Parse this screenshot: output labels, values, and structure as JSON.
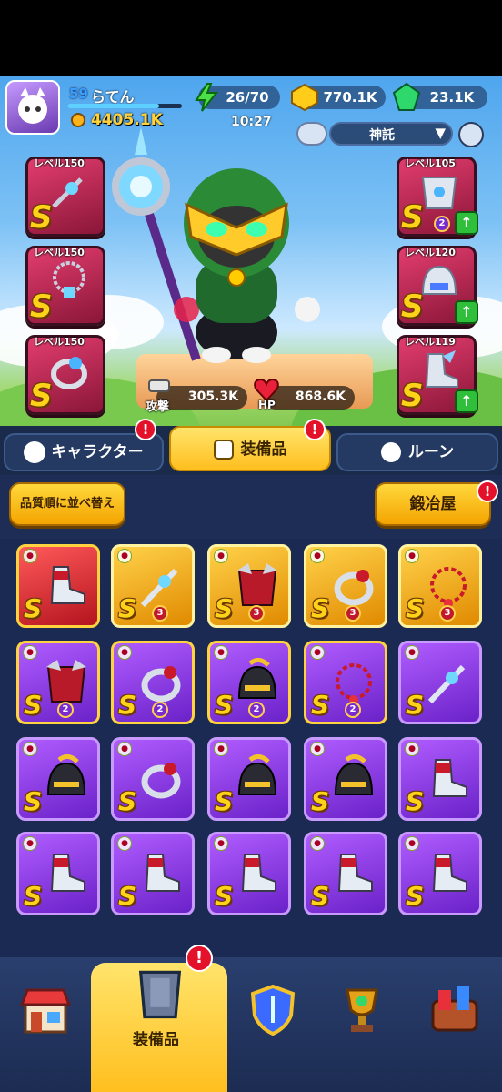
{
  "player": {
    "level": "59",
    "name": "らてん",
    "power": "4405.1K",
    "time": "10:27"
  },
  "resources": {
    "energy": "26/70",
    "gold": "770.1K",
    "gems": "23.1K"
  },
  "title_select": {
    "value": "神託"
  },
  "stats": {
    "attack_label": "攻撃",
    "attack": "305.3K",
    "hp_label": "HP",
    "hp": "868.6K"
  },
  "slots": {
    "left": [
      {
        "label": "レベル150",
        "grade": "S"
      },
      {
        "label": "レベル150",
        "grade": "S"
      },
      {
        "label": "レベル150",
        "grade": "S"
      }
    ],
    "right": [
      {
        "label": "レベル105",
        "grade": "S",
        "count": "2"
      },
      {
        "label": "レベル120",
        "grade": "S"
      },
      {
        "label": "レベル119",
        "grade": "S"
      }
    ]
  },
  "tabs": {
    "character": "キャラクター",
    "equipment": "装備品",
    "rune": "ルーン",
    "badge": "!"
  },
  "buttons": {
    "sort": "品質順に並べ替え",
    "forge": "鍛冶屋"
  },
  "inventory": {
    "rows": [
      [
        {
          "grade": "S",
          "rarity": "red",
          "item": "boots"
        },
        {
          "grade": "S",
          "rarity": "gold",
          "item": "weapon",
          "n": "3"
        },
        {
          "grade": "S",
          "rarity": "gold",
          "item": "armor",
          "n": "3"
        },
        {
          "grade": "S",
          "rarity": "gold",
          "item": "ring",
          "n": "3"
        },
        {
          "grade": "S",
          "rarity": "gold",
          "item": "necklace",
          "n": "3"
        }
      ],
      [
        {
          "grade": "S",
          "rarity": "purpleY",
          "item": "armor",
          "n": "2"
        },
        {
          "grade": "S",
          "rarity": "purpleY",
          "item": "ring",
          "n": "2"
        },
        {
          "grade": "S",
          "rarity": "purpleY",
          "item": "helmet",
          "n": "2"
        },
        {
          "grade": "S",
          "rarity": "purpleY",
          "item": "necklace",
          "n": "2"
        },
        {
          "grade": "S",
          "rarity": "purple",
          "item": "weapon"
        }
      ],
      [
        {
          "grade": "S",
          "rarity": "purple",
          "item": "helmet"
        },
        {
          "grade": "S",
          "rarity": "purple",
          "item": "ring"
        },
        {
          "grade": "S",
          "rarity": "purple",
          "item": "helmet"
        },
        {
          "grade": "S",
          "rarity": "purple",
          "item": "helmet"
        },
        {
          "grade": "S",
          "rarity": "purple",
          "item": "boots"
        }
      ],
      [
        {
          "grade": "S",
          "rarity": "purple",
          "item": "boots"
        },
        {
          "grade": "S",
          "rarity": "purple",
          "item": "boots"
        },
        {
          "grade": "S",
          "rarity": "purple",
          "item": "boots"
        },
        {
          "grade": "S",
          "rarity": "purple",
          "item": "boots"
        },
        {
          "grade": "S",
          "rarity": "purple",
          "item": "boots"
        }
      ]
    ]
  },
  "nav": {
    "active_label": "装備品",
    "items": [
      "shop-icon",
      "equipment-icon",
      "shield-icon",
      "trophy-icon",
      "event-icon"
    ]
  },
  "colors": {
    "accent": "#ffc21f",
    "panel": "#1d2d56",
    "danger": "#e3122a"
  }
}
